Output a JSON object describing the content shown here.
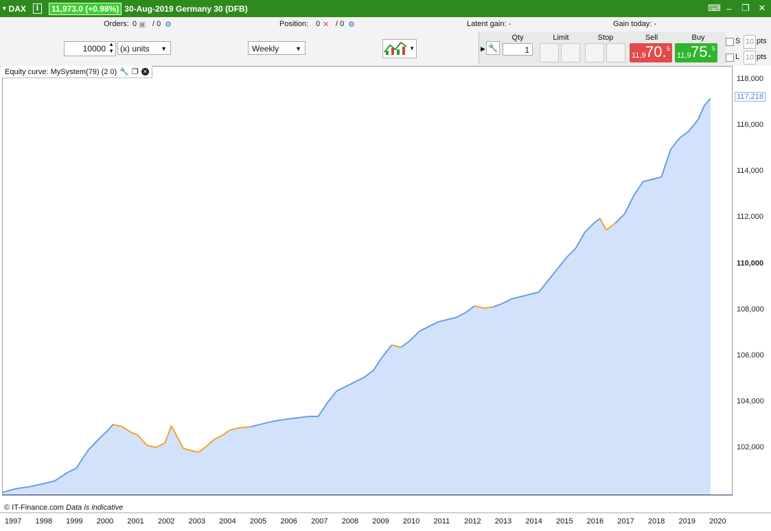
{
  "titlebar": {
    "instrument": "DAX",
    "price_change": "11,973.0 (+0.98%)",
    "description": "30-Aug-2019 Germany 30 (DFB)",
    "icons": [
      "dropdown-arrow-icon",
      "info-icon",
      "keyboard-icon",
      "minimize-icon",
      "restore-icon",
      "close-icon"
    ]
  },
  "status": {
    "orders_label": "Orders:",
    "orders_value_1": "0",
    "orders_value_2": "/ 0",
    "position_label": "Position:",
    "position_value_1": "0",
    "position_value_2": "/ 0",
    "latent_gain": "Latent gain: -",
    "gain_today": "Gain today: -"
  },
  "toolbar": {
    "quantity": "10000",
    "units": "(x) units",
    "timeframe": "Weekly",
    "order_panel": {
      "qty_label": "Qty",
      "qty_value": "1",
      "limit_label": "Limit",
      "stop_label": "Stop",
      "sell_label": "Sell",
      "buy_label": "Buy",
      "sell_small": "11,9",
      "sell_big": "70.",
      "sell_sup": "5",
      "buy_small": "11,9",
      "buy_big": "75.",
      "buy_sup": "5",
      "s_label": "S",
      "l_label": "L",
      "pts_value": "10",
      "pts_label": "pts"
    }
  },
  "chart": {
    "indicator_label": "Equity curve: MySystem(79) (2 0)",
    "footer_credit": "© IT-Finance.com",
    "footer_note": "Data is indicative",
    "y_ticks": [
      "118,000",
      "116,000",
      "114,000",
      "112,000",
      "110,000",
      "108,000",
      "106,000",
      "104,000",
      "102,000"
    ],
    "last_value_label": "117,218",
    "x_ticks": [
      "1997",
      "1998",
      "1999",
      "2000",
      "2001",
      "2002",
      "2003",
      "2004",
      "2005",
      "2006",
      "2007",
      "2008",
      "2009",
      "2010",
      "2011",
      "2012",
      "2013",
      "2014",
      "2015",
      "2016",
      "2017",
      "2018",
      "2019",
      "2020"
    ]
  },
  "chart_data": {
    "type": "area",
    "title": "Equity curve: MySystem(79) (2 0)",
    "xlabel": "",
    "ylabel": "",
    "ylim": [
      100000,
      118600
    ],
    "xlim": [
      1996.6,
      2020.4
    ],
    "grid": false,
    "line_color": "#6b9be6",
    "drawdown_color": "#f5a030",
    "fill_color": "#d2e2fb",
    "x": [
      1996.6,
      1997.0,
      1997.5,
      1998.0,
      1998.3,
      1998.7,
      1999.0,
      1999.4,
      1999.8,
      2000.0,
      2000.2,
      2000.5,
      2000.8,
      2001.0,
      2001.3,
      2001.6,
      2001.9,
      2002.1,
      2002.3,
      2002.5,
      2002.8,
      2003.0,
      2003.2,
      2003.5,
      2003.8,
      2004.0,
      2004.3,
      2004.7,
      2005.0,
      2005.3,
      2005.7,
      2006.0,
      2006.3,
      2006.6,
      2006.9,
      2007.2,
      2007.5,
      2007.8,
      2008.1,
      2008.4,
      2008.7,
      2009.0,
      2009.3,
      2009.6,
      2009.9,
      2010.2,
      2010.5,
      2010.8,
      2011.1,
      2011.4,
      2011.7,
      2012.0,
      2012.3,
      2012.6,
      2012.9,
      2013.2,
      2013.5,
      2013.8,
      2014.1,
      2014.4,
      2014.7,
      2015.0,
      2015.3,
      2015.6,
      2015.9,
      2016.1,
      2016.3,
      2016.6,
      2016.9,
      2017.2,
      2017.5,
      2017.8,
      2018.1,
      2018.4,
      2018.7,
      2019.0,
      2019.3,
      2019.5,
      2019.7
    ],
    "values": [
      100100,
      100250,
      100350,
      100500,
      100600,
      100950,
      101150,
      101950,
      102500,
      102750,
      103050,
      102950,
      102700,
      102600,
      102150,
      102050,
      102250,
      103000,
      102500,
      102000,
      101900,
      101850,
      102050,
      102400,
      102600,
      102800,
      102900,
      102950,
      103050,
      103150,
      103250,
      103300,
      103350,
      103400,
      103400,
      104000,
      104500,
      104700,
      104900,
      105100,
      105400,
      106000,
      106500,
      106400,
      106700,
      107100,
      107300,
      107500,
      107600,
      107700,
      107900,
      108200,
      108100,
      108150,
      108300,
      108500,
      108600,
      108700,
      108800,
      109300,
      109800,
      110300,
      110700,
      111400,
      111800,
      112000,
      111500,
      111800,
      112200,
      113000,
      113600,
      113700,
      113800,
      115000,
      115500,
      115800,
      116300,
      116900,
      117218
    ]
  }
}
